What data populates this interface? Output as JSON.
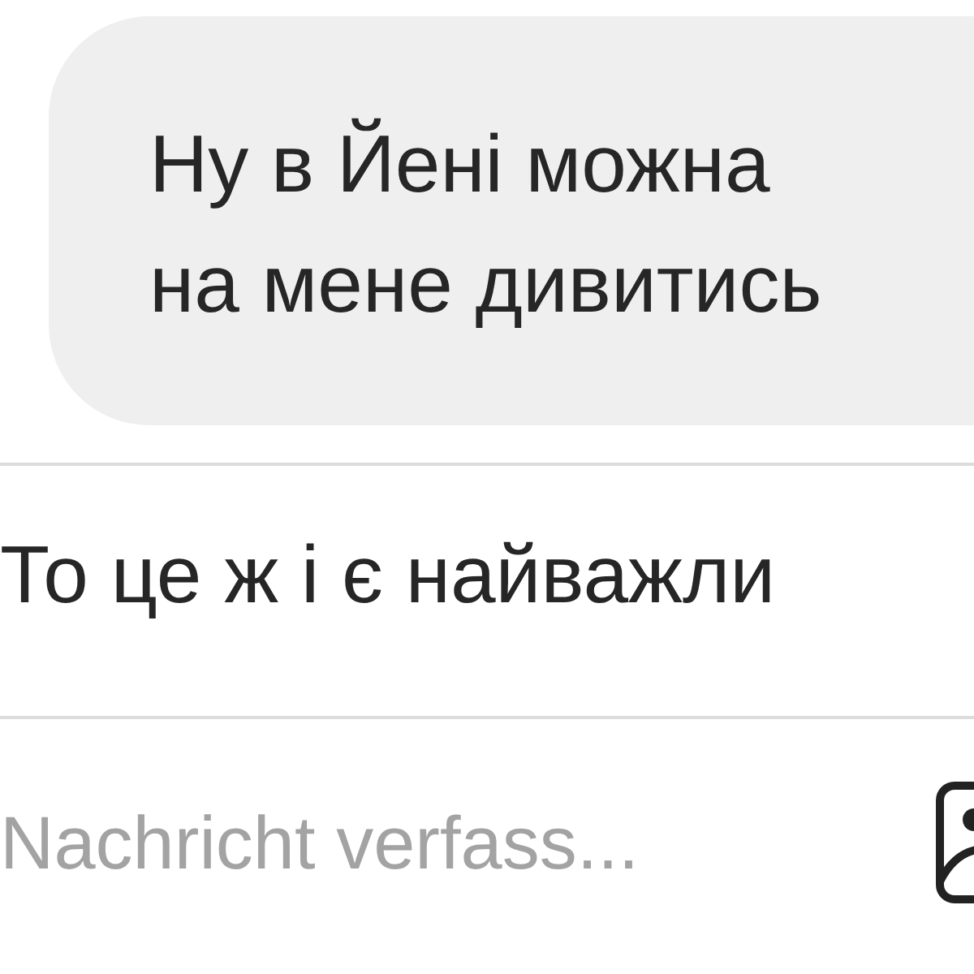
{
  "messages": [
    {
      "kind": "received",
      "lines": [
        "Ну в Йені можна",
        "на мене дивитись"
      ]
    },
    {
      "kind": "sent",
      "lines": [
        "То це ж і є найважли"
      ]
    }
  ],
  "composer": {
    "placeholder": "Nachricht verfass..."
  }
}
